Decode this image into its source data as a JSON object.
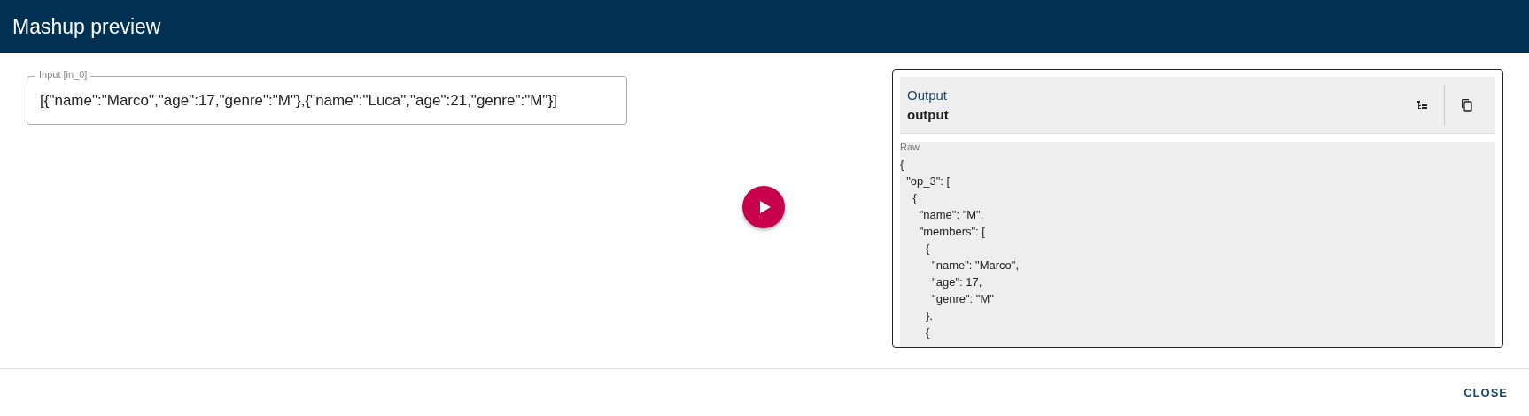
{
  "dialog": {
    "title": "Mashup preview"
  },
  "input": {
    "label": "Input [in_0]",
    "value": "[{\"name\":\"Marco\",\"age\":17,\"genre\":\"M\"},{\"name\":\"Luca\",\"age\":21,\"genre\":\"M\"}]"
  },
  "output": {
    "heading": "Output",
    "name": "output",
    "raw_label": "Raw",
    "raw_lines": [
      "{",
      "  \"op_3\": [",
      "    {",
      "      \"name\": \"M\",",
      "      \"members\": [",
      "        {",
      "          \"name\": \"Marco\",",
      "          \"age\": 17,",
      "          \"genre\": \"M\"",
      "        },",
      "        {"
    ]
  },
  "actions": [
    "CLOSE"
  ]
}
